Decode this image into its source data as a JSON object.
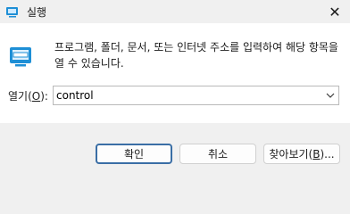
{
  "window": {
    "title": "실행",
    "close_glyph": "✕",
    "app_icon": "run-dialog-icon"
  },
  "content": {
    "description": "프로그램, 폴더, 문서, 또는 인터넷 주소를 입력하여 해당 항목을 열 수 있습니다.",
    "open_label_prefix": "열기(",
    "open_label_key": "O",
    "open_label_suffix": "):",
    "input_value": "control",
    "dropdown_icon": "chevron-down-icon"
  },
  "buttons": {
    "ok": "확인",
    "cancel": "취소",
    "browse_prefix": "찾아보기(",
    "browse_key": "B",
    "browse_suffix": ")..."
  },
  "colors": {
    "dialog_bg": "#f0f0f0",
    "content_bg": "#ffffff",
    "default_button_border": "#3a6ea5",
    "icon_accent": "#1e8fd6"
  }
}
